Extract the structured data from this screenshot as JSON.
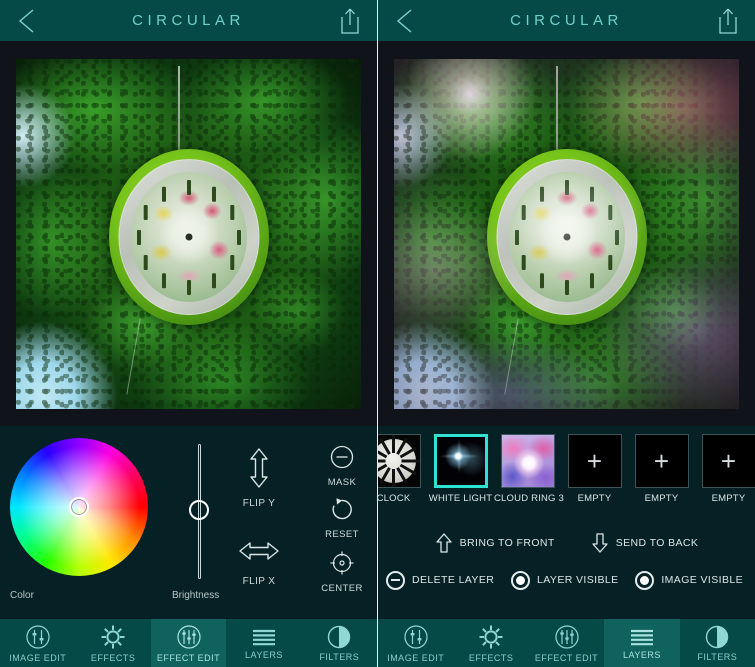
{
  "app": {
    "title": "CIRCULAR",
    "accent_teal": "#064a48",
    "accent_active": "#0f625d",
    "panel_bg": "#062125",
    "photo_bg": "#10141a",
    "selected_border": "#2fe3d2"
  },
  "header": {
    "title": "CIRCULAR",
    "back_icon": "chevron-left-icon",
    "share_icon": "share-upload-icon"
  },
  "left_panel": {
    "photo": {
      "description": "Stereographic tiny-planet photo of a green floral clock surrounded by trees"
    },
    "color_wheel": {
      "label": "Color",
      "knob_position": "center"
    },
    "brightness": {
      "label": "Brightness",
      "value_position": "center"
    },
    "flip_buttons": [
      {
        "label": "FLIP Y",
        "icon": "arrow-up-down-icon"
      },
      {
        "label": "FLIP X",
        "icon": "arrow-left-right-icon"
      }
    ],
    "side_buttons": [
      {
        "label": "MASK",
        "icon": "minus-circle-icon"
      },
      {
        "label": "RESET",
        "icon": "undo-arrow-icon"
      },
      {
        "label": "CENTER",
        "icon": "crosshair-icon"
      }
    ],
    "active_tab": "EFFECT EDIT"
  },
  "right_panel": {
    "photo": {
      "description": "Same tiny-planet clock photo with magenta and purple light-leak effects overlaid"
    },
    "layers": [
      {
        "label": "CLOCK",
        "kind": "clock",
        "selected": false
      },
      {
        "label": "WHITE LIGHT",
        "kind": "light",
        "selected": true
      },
      {
        "label": "CLOUD RING 3",
        "kind": "cloud",
        "selected": false
      },
      {
        "label": "EMPTY",
        "kind": "empty",
        "selected": false
      },
      {
        "label": "EMPTY",
        "kind": "empty",
        "selected": false
      },
      {
        "label": "EMPTY",
        "kind": "empty",
        "selected": false
      }
    ],
    "order_actions": [
      {
        "label": "BRING TO FRONT",
        "icon": "arrow-up-outline-icon"
      },
      {
        "label": "SEND TO BACK",
        "icon": "arrow-down-outline-icon"
      }
    ],
    "visibility_actions": [
      {
        "label": "DELETE LAYER",
        "icon": "minus-circle-icon",
        "state": "off"
      },
      {
        "label": "LAYER VISIBLE",
        "icon": "radio-on-icon",
        "state": "on"
      },
      {
        "label": "IMAGE VISIBLE",
        "icon": "radio-on-icon",
        "state": "on"
      }
    ],
    "active_tab": "LAYERS"
  },
  "tabs": [
    {
      "label": "IMAGE EDIT",
      "icon": "sliders-circle-icon"
    },
    {
      "label": "EFFECTS",
      "icon": "sun-icon"
    },
    {
      "label": "EFFECT EDIT",
      "icon": "sliders-circle-icon"
    },
    {
      "label": "LAYERS",
      "icon": "stacked-lines-icon"
    },
    {
      "label": "FILTERS",
      "icon": "half-circle-icon"
    }
  ]
}
